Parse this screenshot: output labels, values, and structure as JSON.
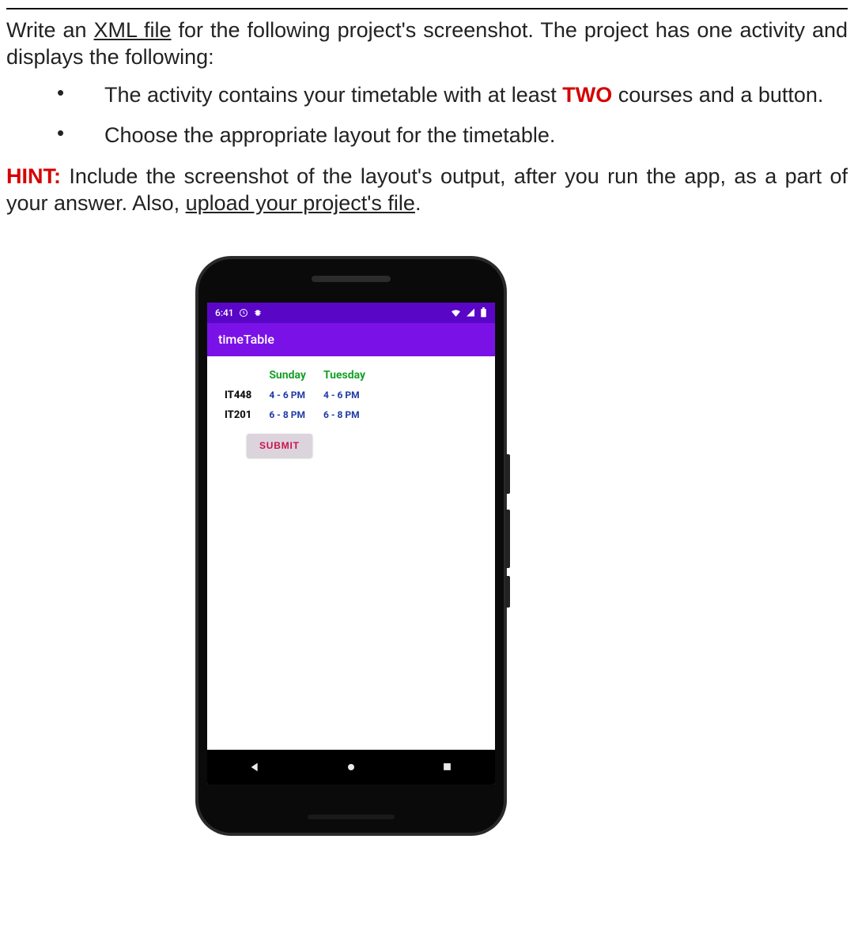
{
  "question": {
    "intro_prefix": "Write an ",
    "intro_underline": "XML file",
    "intro_suffix": " for the following project's screenshot. The project has one activity and displays the following:",
    "bullet1_prefix": "The activity contains your timetable with at least ",
    "bullet1_red": "TWO",
    "bullet1_suffix": " courses and a button.",
    "bullet2": "Choose the appropriate layout for the timetable.",
    "hint_label": "HINT:",
    "hint_body_prefix": " Include the screenshot of the layout's output, after you run the app, as a part of your answer. Also, ",
    "hint_underline": "upload your project's file",
    "hint_period": "."
  },
  "phone": {
    "status": {
      "time": "6:41"
    },
    "appbar": {
      "title": "timeTable"
    },
    "table": {
      "headers": {
        "col1": "",
        "col2": "Sunday",
        "col3": "Tuesday"
      },
      "rows": [
        {
          "code": "IT448",
          "sun": "4 - 6 PM",
          "tue": "4 - 6 PM"
        },
        {
          "code": "IT201",
          "sun": "6 - 8 PM",
          "tue": "6 - 8 PM"
        }
      ]
    },
    "submit_label": "SUBMIT"
  }
}
